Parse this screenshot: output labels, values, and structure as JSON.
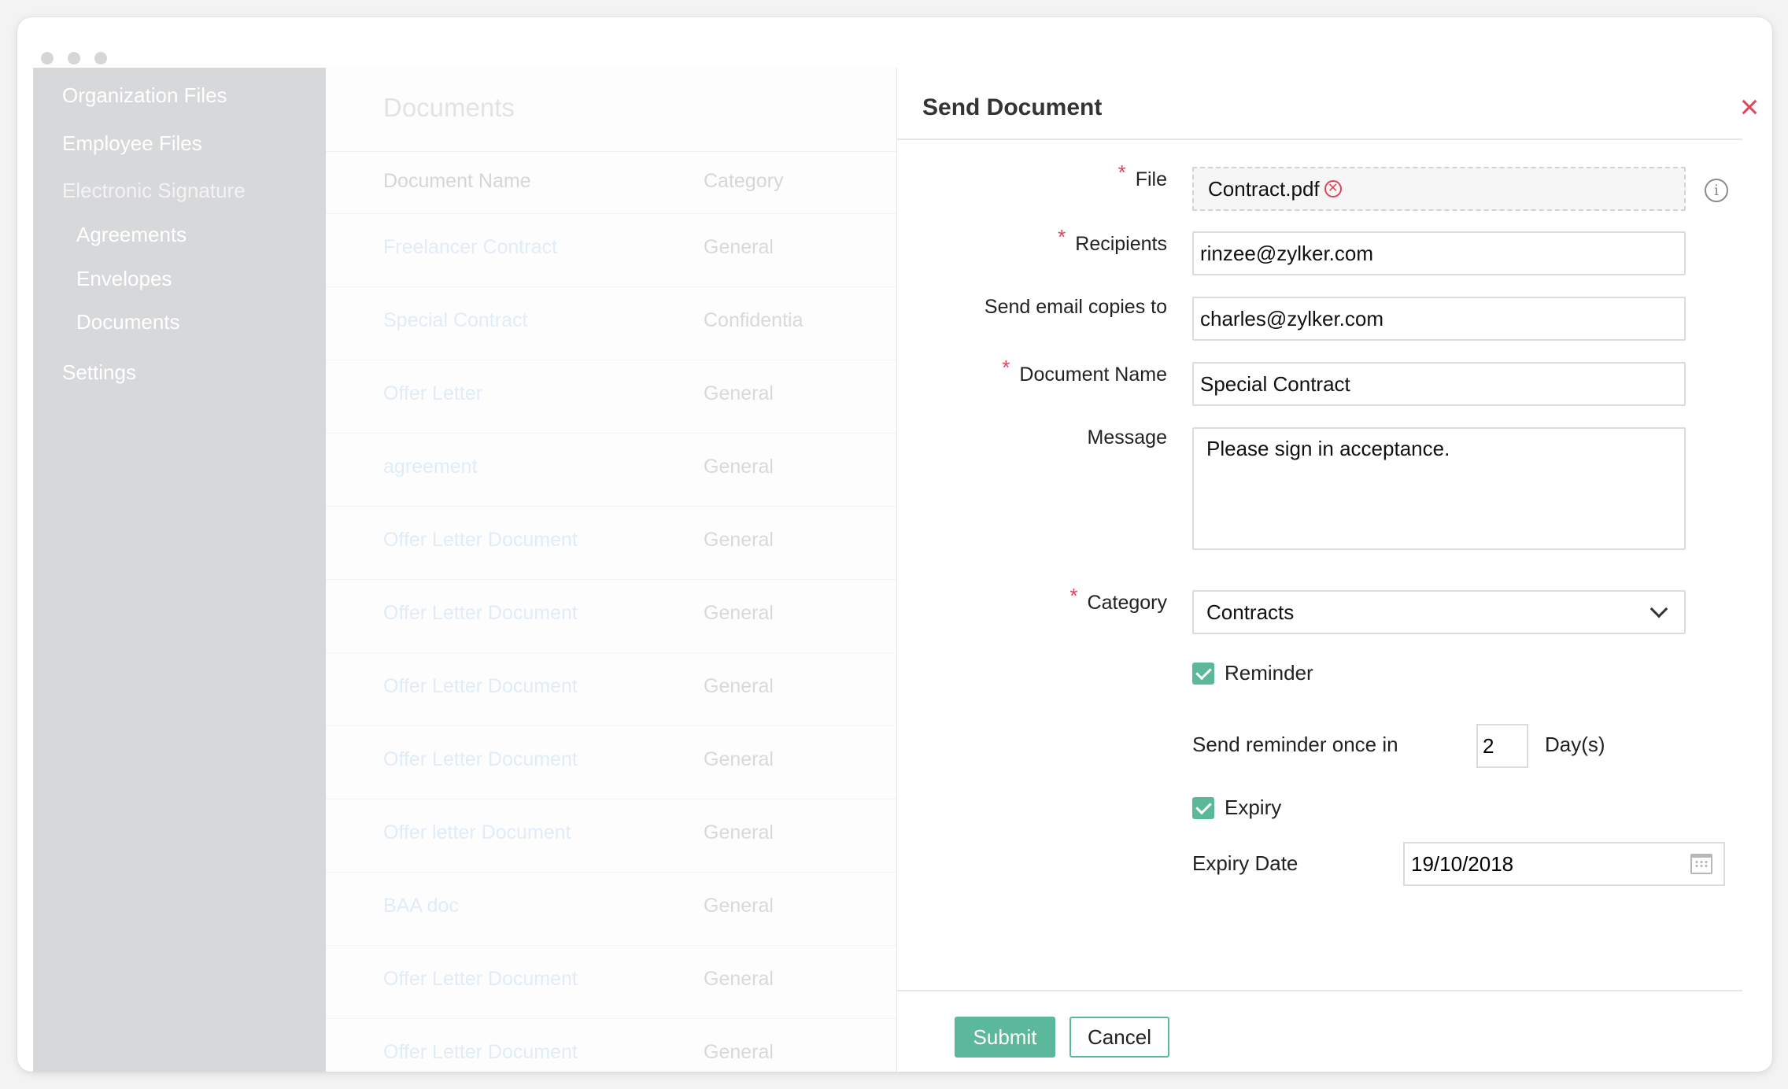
{
  "sidebar": {
    "items": [
      {
        "label": "Organization Files"
      },
      {
        "label": "Employee Files"
      },
      {
        "label": "Electronic Signature"
      },
      {
        "label": "Agreements"
      },
      {
        "label": "Envelopes"
      },
      {
        "label": "Documents"
      },
      {
        "label": "Settings"
      }
    ]
  },
  "list": {
    "title": "Documents",
    "columns": [
      "Document Name",
      "Category"
    ],
    "rows": [
      {
        "name": "Freelancer Contract",
        "category": "General"
      },
      {
        "name": "Special Contract",
        "category": "Confidentia"
      },
      {
        "name": "Offer Letter",
        "category": "General"
      },
      {
        "name": "agreement",
        "category": "General"
      },
      {
        "name": "Offer Letter Document",
        "category": "General"
      },
      {
        "name": "Offer Letter Document",
        "category": "General"
      },
      {
        "name": "Offer Letter Document",
        "category": "General"
      },
      {
        "name": "Offer Letter Document",
        "category": "General"
      },
      {
        "name": "Offer letter Document",
        "category": "General"
      },
      {
        "name": "BAA doc",
        "category": "General"
      },
      {
        "name": "Offer Letter Document",
        "category": "General"
      },
      {
        "name": "Offer Letter Document",
        "category": "General"
      }
    ]
  },
  "dialog": {
    "title": "Send Document",
    "fields": {
      "file": {
        "label": "File",
        "value": "Contract.pdf"
      },
      "recipients": {
        "label": "Recipients",
        "value": "rinzee@zylker.com"
      },
      "copies": {
        "label": "Send email copies to",
        "value": "charles@zylker.com"
      },
      "doc_name": {
        "label": "Document Name",
        "value": "Special Contract"
      },
      "message": {
        "label": "Message",
        "value": "Please sign in acceptance."
      },
      "category": {
        "label": "Category",
        "value": "Contracts"
      }
    },
    "reminder": {
      "label": "Reminder",
      "checked": true,
      "interval_label": "Send reminder once in",
      "interval_value": "2",
      "unit": "Day(s)"
    },
    "expiry": {
      "label": "Expiry",
      "checked": true,
      "date_label": "Expiry Date",
      "date_value": "19/10/2018"
    },
    "buttons": {
      "submit": "Submit",
      "cancel": "Cancel"
    }
  },
  "colors": {
    "accent": "#5bb89a",
    "required": "#e0445a",
    "sidebar_bg": "#d7d8da"
  }
}
